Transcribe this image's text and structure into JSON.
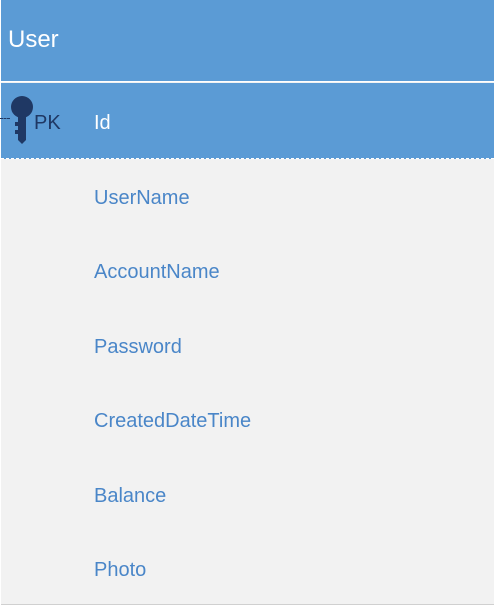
{
  "entity": {
    "title": "User",
    "primary_key": {
      "marker": "PK",
      "name": "Id",
      "icon": "key-icon"
    },
    "fields": [
      "UserName",
      "AccountName",
      "Password",
      "CreatedDateTime",
      "Balance",
      "Photo"
    ],
    "colors": {
      "header": "#5b9bd5",
      "body": "#f2f2f2",
      "field_text": "#4a86c8",
      "key_icon": "#1f3864"
    }
  }
}
